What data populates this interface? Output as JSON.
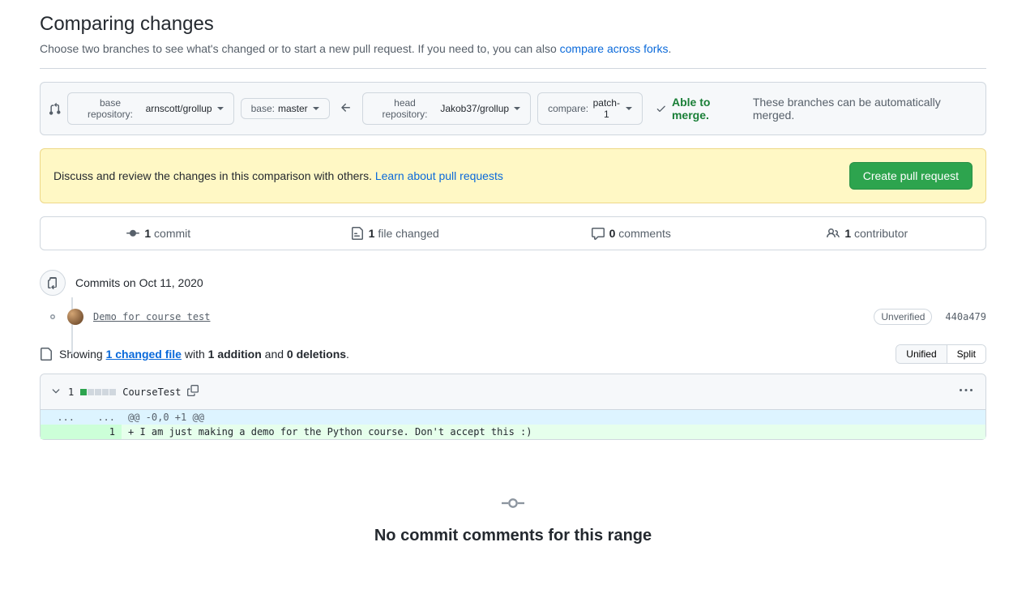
{
  "header": {
    "title": "Comparing changes",
    "subtitle_prefix": "Choose two branches to see what's changed or to start a new pull request. If you need to, you can also ",
    "subtitle_link": "compare across forks",
    "subtitle_suffix": "."
  },
  "range": {
    "base_repo_label": "base repository: ",
    "base_repo_value": "arnscott/grollup",
    "base_label": "base: ",
    "base_value": "master",
    "head_repo_label": "head repository: ",
    "head_repo_value": "Jakob37/grollup",
    "compare_label": "compare: ",
    "compare_value": "patch-1",
    "merge_able": "Able to merge.",
    "merge_desc": "These branches can be automatically merged."
  },
  "banner": {
    "text": "Discuss and review the changes in this comparison with others. ",
    "link": "Learn about pull requests",
    "button": "Create pull request"
  },
  "stats": {
    "commits_n": "1",
    "commits_label": "commit",
    "files_n": "1",
    "files_label": "file changed",
    "comments_n": "0",
    "comments_label": "comments",
    "contrib_n": "1",
    "contrib_label": "contributor"
  },
  "commits": {
    "date_header": "Commits on Oct 11, 2020",
    "items": [
      {
        "msg": "Demo for course test",
        "verified": "Unverified",
        "sha": "440a479"
      }
    ]
  },
  "diff_summary": {
    "showing": "Showing ",
    "changed_link": "1 changed file",
    "with": " with ",
    "additions": "1 addition",
    "and": " and ",
    "deletions": "0 deletions",
    "period": ".",
    "unified": "Unified",
    "split": "Split"
  },
  "file": {
    "change_count": "1",
    "name": "CourseTest",
    "hunk": "@@ -0,0 +1 @@",
    "add_line_num": "1",
    "add_line": "+ I am just making a demo for the Python course. Don't accept this :)"
  },
  "empty": {
    "title": "No commit comments for this range"
  }
}
